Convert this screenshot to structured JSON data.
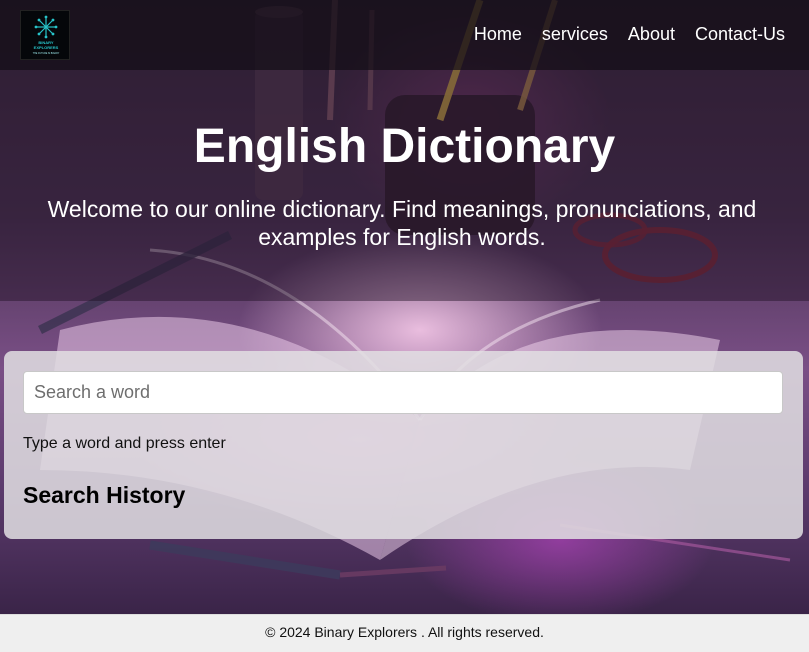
{
  "header": {
    "logo": {
      "icon": "starburst-logo-icon",
      "text_line1": "BINARY",
      "text_line2": "EXPLORERS",
      "tagline": "THE FUTURE IS BINARY",
      "accent": "#27c4c9"
    },
    "nav": {
      "items": [
        {
          "label": "Home"
        },
        {
          "label": "services"
        },
        {
          "label": "About"
        },
        {
          "label": "Contact-Us"
        }
      ]
    }
  },
  "hero": {
    "title": "English Dictionary",
    "subtitle": "Welcome to our online dictionary. Find meanings, pronunciations, and examples for English words."
  },
  "search": {
    "placeholder": "Search a word",
    "value": "",
    "hint": "Type a word and press enter",
    "history_title": "Search History"
  },
  "footer": {
    "text": "© 2024 Binary Explorers . All rights reserved."
  },
  "colors": {
    "header_bg": "#140e16",
    "footer_bg": "#efefef",
    "card_bg": "#e1dee2",
    "accent_pink": "#e27bd8"
  }
}
